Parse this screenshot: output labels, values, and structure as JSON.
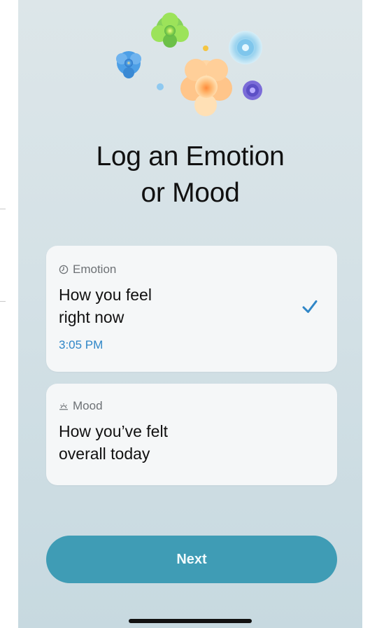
{
  "title": {
    "line1": "Log an Emotion",
    "line2": "or Mood"
  },
  "options": {
    "emotion": {
      "kicker": "Emotion",
      "kicker_icon": "clock-icon",
      "main_line1": "How you feel",
      "main_line2": "right now",
      "time": "3:05 PM",
      "selected": true
    },
    "mood": {
      "kicker": "Mood",
      "kicker_icon": "sunrise-icon",
      "main_line1": "How you’ve felt",
      "main_line2": "overall today",
      "selected": false
    }
  },
  "next_button": {
    "label": "Next"
  },
  "colors": {
    "accent": "#3f9cb5",
    "time": "#2f86c7",
    "check": "#2f86c7",
    "card_bg": "#f5f7f8"
  },
  "decorative": {
    "header_art": "flowers-illustration"
  }
}
